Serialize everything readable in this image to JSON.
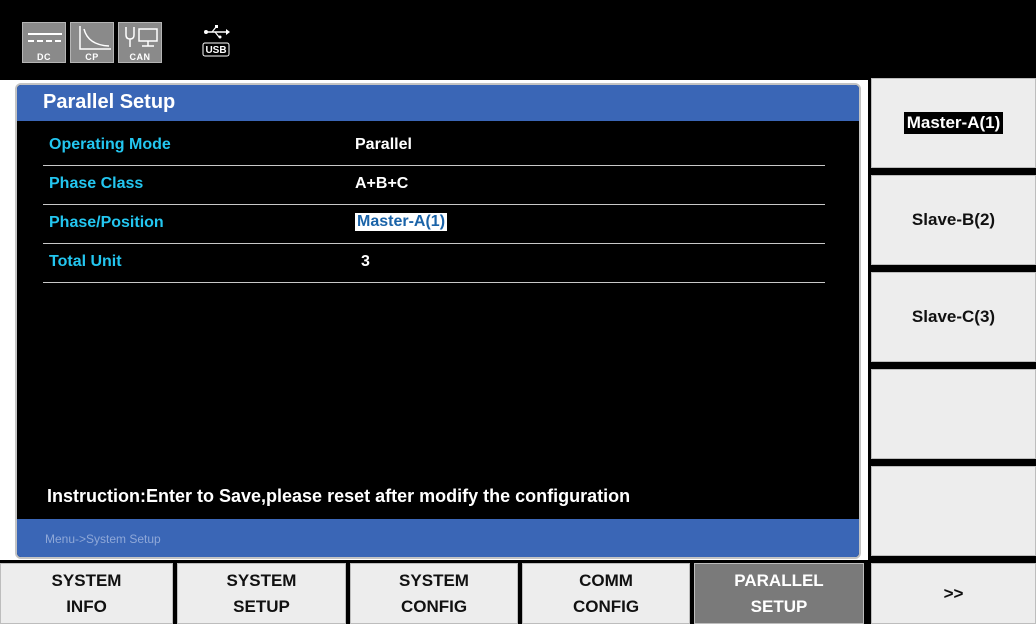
{
  "status_icons": [
    {
      "name": "dc-mode-icon",
      "label": "DC"
    },
    {
      "name": "cp-mode-icon",
      "label": "CP"
    },
    {
      "name": "can-icon",
      "label": "CAN"
    },
    {
      "name": "usb-icon",
      "label": "USB"
    }
  ],
  "panel": {
    "title": "Parallel Setup",
    "rows": [
      {
        "label": "Operating Mode",
        "value": "Parallel"
      },
      {
        "label": "Phase Class",
        "value": "A+B+C"
      },
      {
        "label": "Phase/Position",
        "value": "Master-A(1)"
      },
      {
        "label": "Total Unit",
        "value": "3"
      }
    ],
    "instruction": "Instruction:Enter to Save,please reset after modify the configuration",
    "breadcrumb": "Menu->System Setup"
  },
  "softkeys": [
    "Master-A(1)",
    "Slave-B(2)",
    "Slave-C(3)",
    "",
    ""
  ],
  "tabs": [
    {
      "line1": "SYSTEM",
      "line2": "INFO"
    },
    {
      "line1": "SYSTEM",
      "line2": "SETUP"
    },
    {
      "line1": "SYSTEM",
      "line2": "CONFIG"
    },
    {
      "line1": "COMM",
      "line2": "CONFIG"
    },
    {
      "line1": "PARALLEL",
      "line2": "SETUP"
    },
    {
      "line1": ">>",
      "line2": ""
    }
  ],
  "colors": {
    "accent_blue": "#3a66b6",
    "label_cyan": "#23c6f0",
    "active_tab": "#7a7a7a"
  }
}
